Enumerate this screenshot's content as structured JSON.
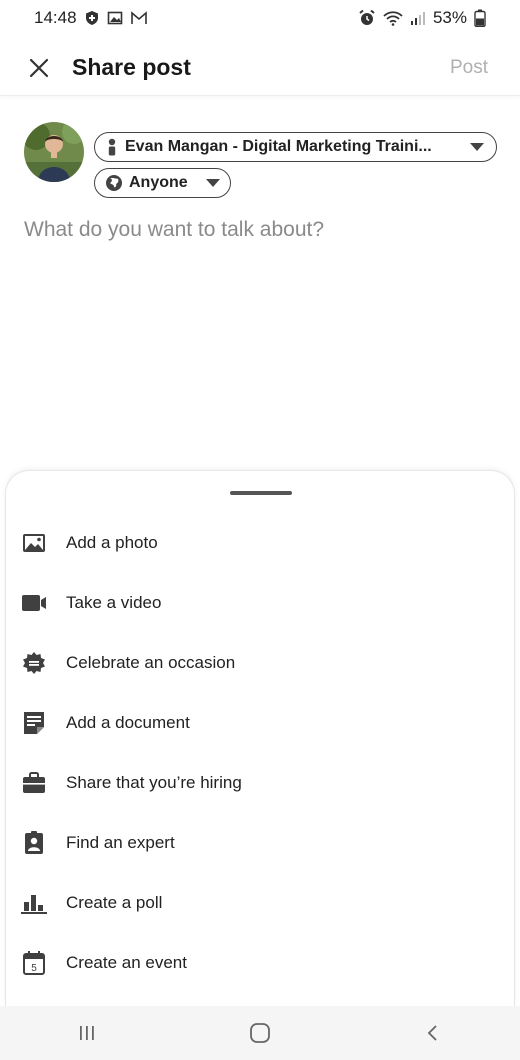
{
  "status_bar": {
    "time": "14:48",
    "battery": "53%"
  },
  "header": {
    "title": "Share post",
    "post_label": "Post"
  },
  "author": {
    "name": "Evan Mangan - Digital Marketing Traini...",
    "visibility": "Anyone"
  },
  "composer": {
    "placeholder": "What do you want to talk about?"
  },
  "actions": [
    {
      "label": "Add a photo",
      "icon": "photo-icon"
    },
    {
      "label": "Take a video",
      "icon": "video-icon"
    },
    {
      "label": "Celebrate an occasion",
      "icon": "celebrate-icon"
    },
    {
      "label": "Add a document",
      "icon": "document-icon"
    },
    {
      "label": "Share that you’re hiring",
      "icon": "briefcase-icon"
    },
    {
      "label": "Find an expert",
      "icon": "expert-icon"
    },
    {
      "label": "Create a poll",
      "icon": "poll-icon"
    },
    {
      "label": "Create an event",
      "icon": "calendar-icon"
    }
  ],
  "calendar_icon_day": "5",
  "colors": {
    "text": "#191919",
    "icon": "#404040",
    "muted": "#8a8a8a",
    "post_disabled": "#b0b0b0",
    "nav_bg": "#f5f5f5"
  }
}
